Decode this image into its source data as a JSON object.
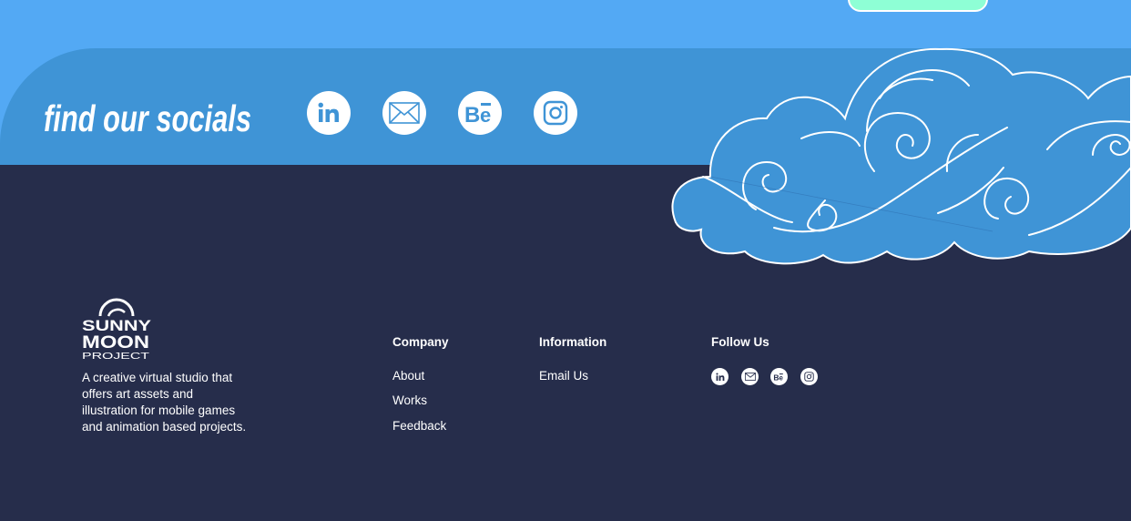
{
  "colors": {
    "sky_blue": "#53a9f4",
    "socials_band": "#3f94d6",
    "footer_navy": "#262d4b",
    "mint_accent": "#8effd5",
    "white": "#ffffff"
  },
  "socials_banner": {
    "heading": "find our socials",
    "links": [
      {
        "icon": "linkedin-icon"
      },
      {
        "icon": "mail-icon"
      },
      {
        "icon": "behance-icon"
      },
      {
        "icon": "instagram-icon"
      }
    ]
  },
  "footer": {
    "logo": {
      "line1": "SUNNY",
      "line2": "MOON",
      "line3": "PROJECT"
    },
    "tagline_lines": [
      "A creative virtual studio that",
      "offers art assets and",
      "illustration for mobile games",
      "and animation based projects."
    ],
    "columns": {
      "company": {
        "title": "Company",
        "links": [
          "About",
          "Works",
          "Feedback"
        ]
      },
      "information": {
        "title": "Information",
        "links": [
          "Email Us"
        ]
      },
      "follow": {
        "title": "Follow Us",
        "icons": [
          "linkedin-icon",
          "mail-icon",
          "behance-icon",
          "instagram-icon"
        ]
      }
    }
  }
}
